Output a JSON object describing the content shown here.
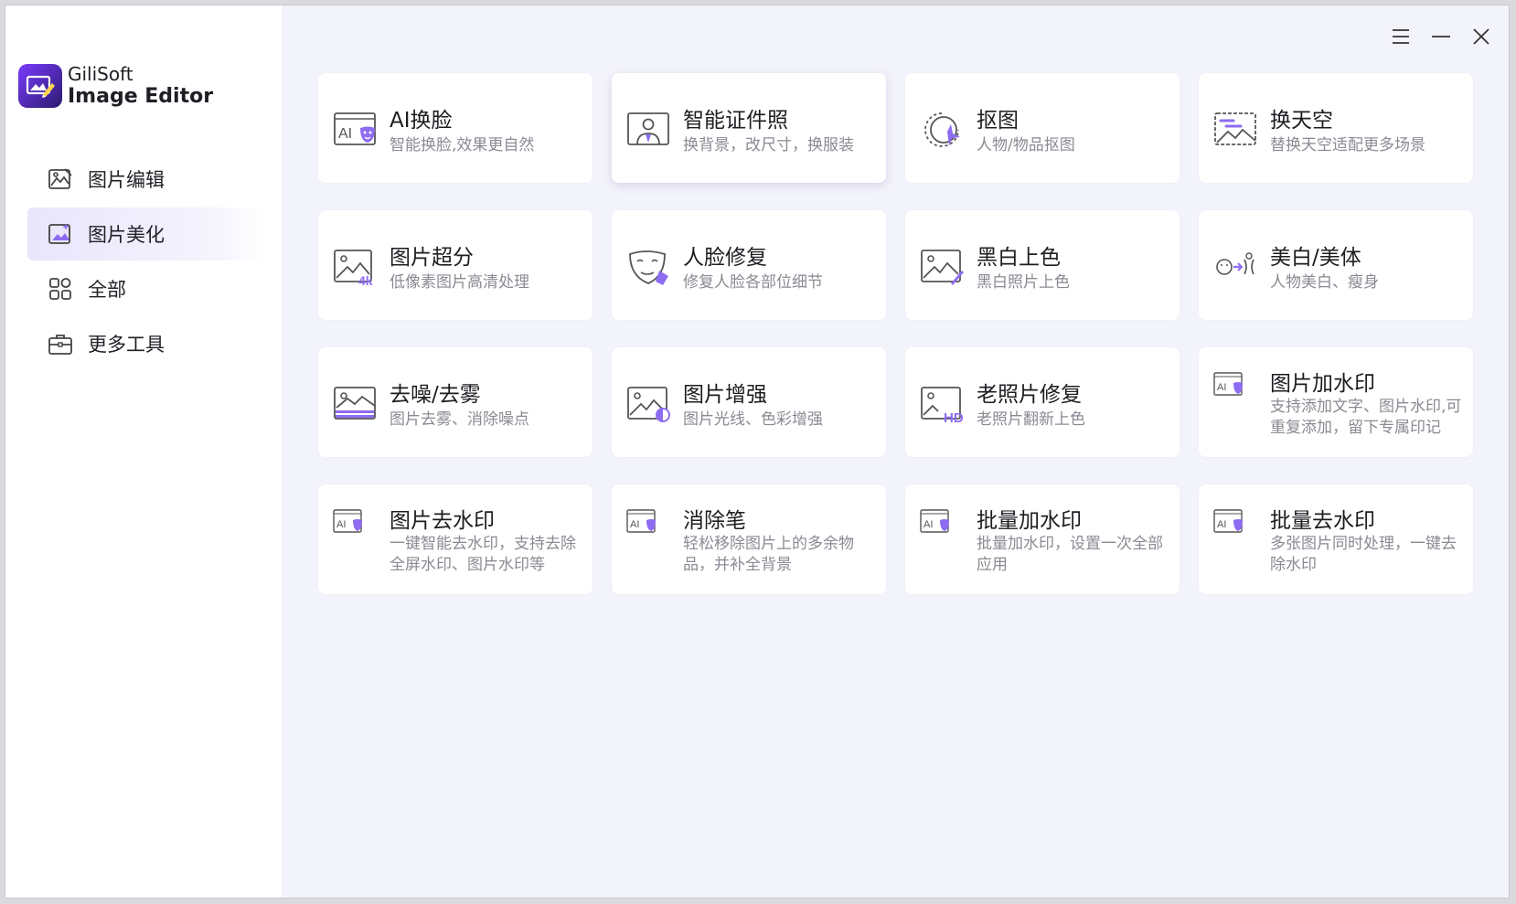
{
  "app": {
    "name_line1": "GiliSoft",
    "name_line2": "Image Editor"
  },
  "colors": {
    "accent": "#7b5cf0",
    "active_bg": "#ece8fb",
    "icon": "#555560"
  },
  "sidebar": {
    "items": [
      {
        "label": "图片编辑",
        "icon": "image-edit-icon",
        "active": false
      },
      {
        "label": "图片美化",
        "icon": "image-beautify-icon",
        "active": true
      },
      {
        "label": "全部",
        "icon": "all-grid-icon",
        "active": false
      },
      {
        "label": "更多工具",
        "icon": "toolbox-icon",
        "active": false
      }
    ]
  },
  "titlebar": {
    "menu": "menu-icon",
    "minimize": "minimize-icon",
    "close": "close-icon"
  },
  "cards": [
    {
      "title": "AI换脸",
      "desc": "智能换脸,效果更自然",
      "icon": "ai-face-swap-icon"
    },
    {
      "title": "智能证件照",
      "desc": "换背景，改尺寸，换服装",
      "icon": "id-photo-icon"
    },
    {
      "title": "抠图",
      "desc": "人物/物品抠图",
      "icon": "cutout-icon"
    },
    {
      "title": "换天空",
      "desc": "替换天空适配更多场景",
      "icon": "sky-replace-icon"
    },
    {
      "title": "图片超分",
      "desc": "低像素图片高清处理",
      "icon": "super-resolution-icon"
    },
    {
      "title": "人脸修复",
      "desc": "修复人脸各部位细节",
      "icon": "face-repair-icon"
    },
    {
      "title": "黑白上色",
      "desc": "黑白照片上色",
      "icon": "colorize-icon"
    },
    {
      "title": "美白/美体",
      "desc": "人物美白、瘦身",
      "icon": "beauty-body-icon"
    },
    {
      "title": "去噪/去雾",
      "desc": "图片去雾、消除噪点",
      "icon": "denoise-icon"
    },
    {
      "title": "图片增强",
      "desc": "图片光线、色彩增强",
      "icon": "enhance-icon"
    },
    {
      "title": "老照片修复",
      "desc": "老照片翻新上色",
      "icon": "old-photo-hd-icon"
    },
    {
      "title": "图片加水印",
      "desc": "支持添加文字、图片水印,可重复添加，留下专属印记",
      "icon": "ai-watermark-icon"
    },
    {
      "title": "图片去水印",
      "desc": "一键智能去水印，支持去除全屏水印、图片水印等",
      "icon": "ai-watermark-icon"
    },
    {
      "title": "消除笔",
      "desc": "轻松移除图片上的多余物品，并补全背景",
      "icon": "ai-watermark-icon"
    },
    {
      "title": "批量加水印",
      "desc": "批量加水印，设置一次全部应用",
      "icon": "ai-watermark-icon"
    },
    {
      "title": "批量去水印",
      "desc": "多张图片同时处理，一键去除水印",
      "icon": "ai-watermark-icon"
    }
  ]
}
